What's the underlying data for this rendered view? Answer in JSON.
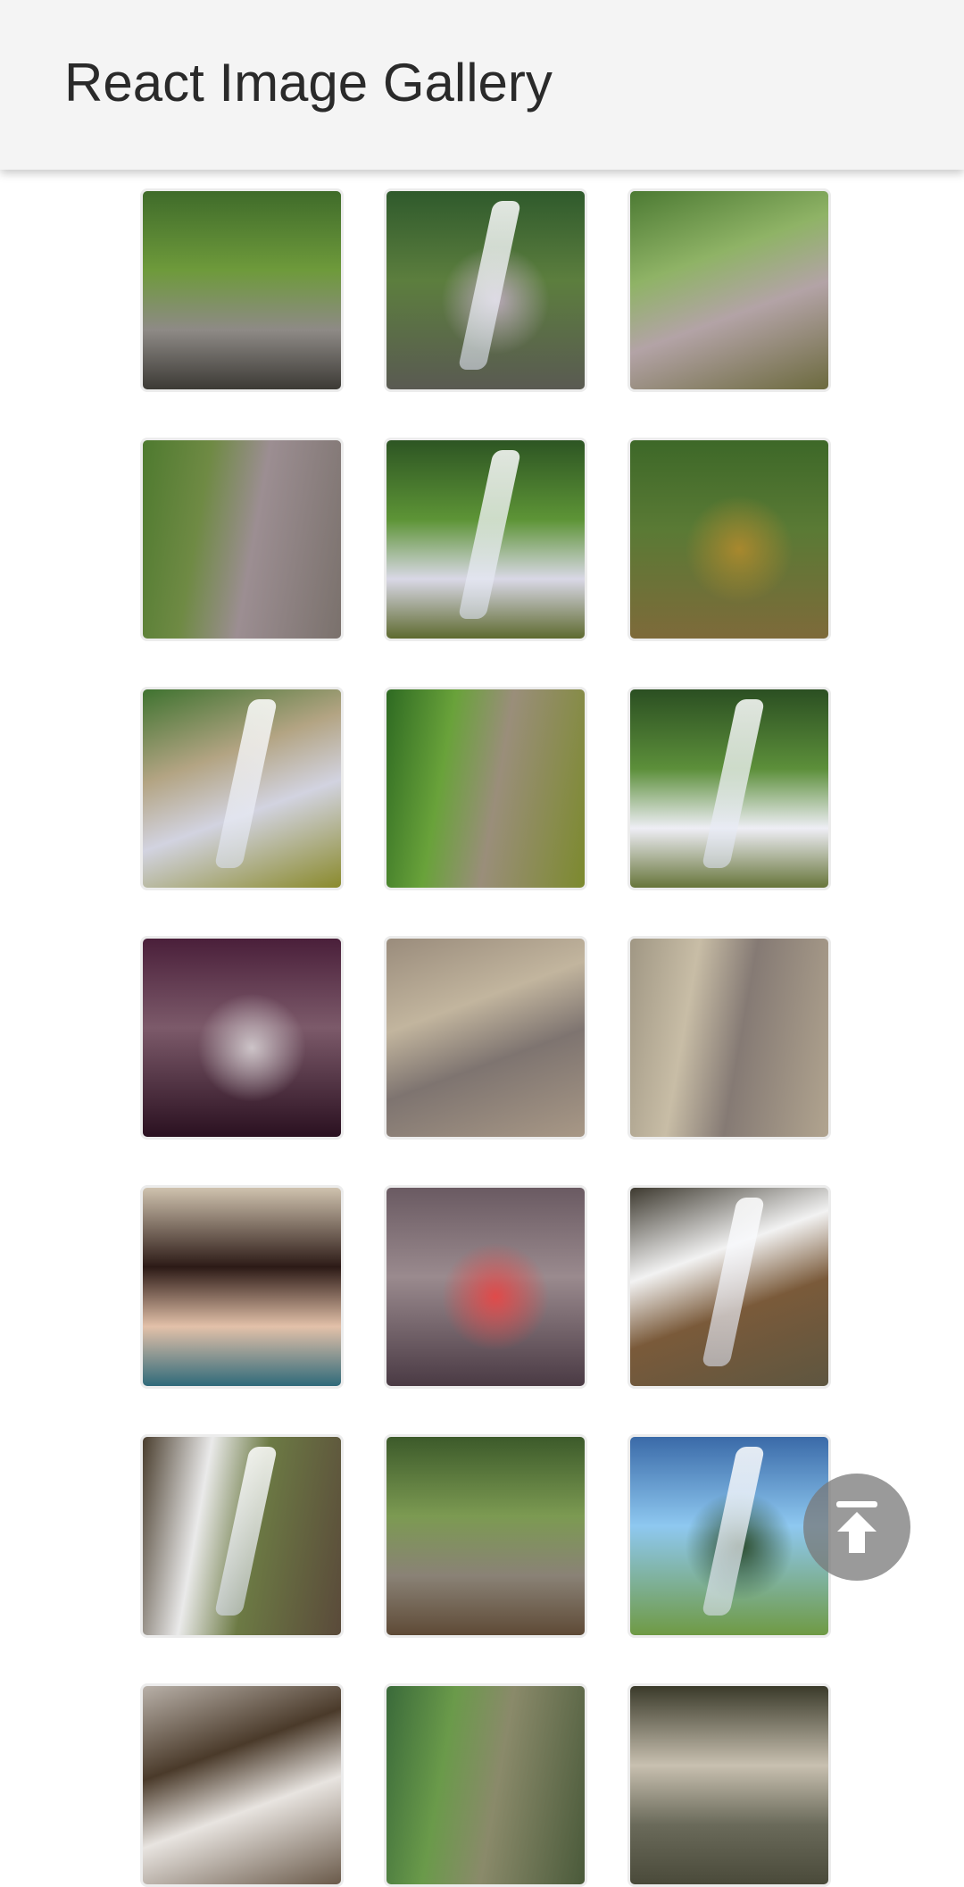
{
  "header": {
    "title": "React Image Gallery"
  },
  "gallery": {
    "thumbnails": [
      {
        "name": "thumbnail-1",
        "style": "forest-stream-log",
        "colors": [
          "#3f6b2a",
          "#6e9a3b",
          "#8e8a86",
          "#3c3a35"
        ]
      },
      {
        "name": "thumbnail-2",
        "style": "forest-cascade",
        "colors": [
          "#2f5a2c",
          "#5c7e3e",
          "#b7a8b6",
          "#5a5a52"
        ]
      },
      {
        "name": "thumbnail-3",
        "style": "forest-river",
        "colors": [
          "#4c7a33",
          "#8fb366",
          "#b3a3a6",
          "#6c6a3e"
        ]
      },
      {
        "name": "thumbnail-4",
        "style": "rocky-stream",
        "colors": [
          "#4e7a2f",
          "#6f8a44",
          "#9c8e92",
          "#7a716c"
        ]
      },
      {
        "name": "thumbnail-5",
        "style": "narrow-waterfall",
        "colors": [
          "#2d5523",
          "#5d9436",
          "#d9d8e6",
          "#5e6a2f"
        ]
      },
      {
        "name": "thumbnail-6",
        "style": "mossy-pool",
        "colors": [
          "#3d6828",
          "#5a7a35",
          "#a8882e",
          "#7e6a3a"
        ]
      },
      {
        "name": "thumbnail-7",
        "style": "small-falls",
        "colors": [
          "#3f7330",
          "#b3a483",
          "#d2d3e0",
          "#8a8a2c"
        ]
      },
      {
        "name": "thumbnail-8",
        "style": "jungle-slope",
        "colors": [
          "#2e6a22",
          "#69a23a",
          "#9a8e7a",
          "#7c8a2e"
        ]
      },
      {
        "name": "thumbnail-9",
        "style": "tall-waterfall",
        "colors": [
          "#2b4f22",
          "#5c8f3a",
          "#eeeef5",
          "#67753a"
        ]
      },
      {
        "name": "thumbnail-10",
        "style": "purple-canyon",
        "colors": [
          "#4a1f3a",
          "#7c5a6a",
          "#cdc4c8",
          "#2a1020"
        ]
      },
      {
        "name": "thumbnail-11",
        "style": "rock-face",
        "colors": [
          "#9a8c7c",
          "#c2b59e",
          "#7e7470",
          "#a89886"
        ]
      },
      {
        "name": "thumbnail-12",
        "style": "rock-face-2",
        "colors": [
          "#a09784",
          "#c8bda6",
          "#857a74",
          "#b1a48f"
        ]
      },
      {
        "name": "thumbnail-13",
        "style": "person-smiling",
        "colors": [
          "#cfc2ae",
          "#2c1a16",
          "#e3c1a9",
          "#2f6a7a"
        ]
      },
      {
        "name": "thumbnail-14",
        "style": "cave-people",
        "colors": [
          "#6a5a62",
          "#9a8a8e",
          "#e04a4a",
          "#4a3a44"
        ]
      },
      {
        "name": "thumbnail-15",
        "style": "rocky-rapids",
        "colors": [
          "#3e3a30",
          "#f2f2f2",
          "#7a5a3a",
          "#5e5640"
        ]
      },
      {
        "name": "thumbnail-16",
        "style": "forest-rapids",
        "colors": [
          "#4a3e2e",
          "#eaeaea",
          "#6c7a44",
          "#5a4a3a"
        ]
      },
      {
        "name": "thumbnail-17",
        "style": "forest-boulder",
        "colors": [
          "#3c5a2a",
          "#7c9a52",
          "#8a8276",
          "#5e4a36"
        ]
      },
      {
        "name": "thumbnail-18",
        "style": "blue-waterfall",
        "colors": [
          "#3a6aa8",
          "#8ec8f0",
          "#2a4a2a",
          "#6f9a44"
        ]
      },
      {
        "name": "thumbnail-19",
        "style": "partial-1",
        "colors": [
          "#b8b0a8",
          "#4a3a2a",
          "#e8e4e0",
          "#6a5a4a"
        ]
      },
      {
        "name": "thumbnail-20",
        "style": "partial-2",
        "colors": [
          "#3a6a3a",
          "#6a9a4a",
          "#8a8a6a",
          "#4a5a3a"
        ]
      },
      {
        "name": "thumbnail-21",
        "style": "partial-3",
        "colors": [
          "#3a3a2a",
          "#c8c0b0",
          "#6a6a5a",
          "#4a4a3a"
        ]
      }
    ]
  },
  "scroll_to_top": {
    "icon": "arrow-up-to-line-icon"
  }
}
